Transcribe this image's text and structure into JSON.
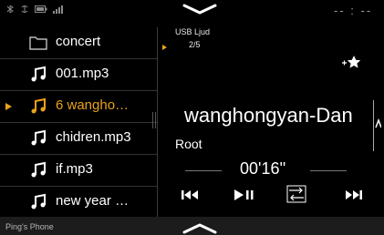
{
  "clock": "-- : --",
  "list": {
    "items": [
      {
        "label": "concert",
        "icon": "folder-icon"
      },
      {
        "label": "001.mp3",
        "icon": "music-note-icon"
      },
      {
        "label": "6  wangho…",
        "icon": "music-note-icon",
        "active": true
      },
      {
        "label": "chidren.mp3",
        "icon": "music-note-icon"
      },
      {
        "label": "if.mp3",
        "icon": "music-note-icon"
      },
      {
        "label": "new year …",
        "icon": "music-note-icon"
      }
    ]
  },
  "footer": {
    "phone": "Ping's Phone"
  },
  "player": {
    "source": "USB Ljud",
    "track_number": "2/5",
    "title": "wanghongyan-Dan",
    "folder": "Root",
    "elapsed": "00'16''"
  },
  "colors": {
    "accent": "#e8a21a",
    "background": "#000000"
  }
}
